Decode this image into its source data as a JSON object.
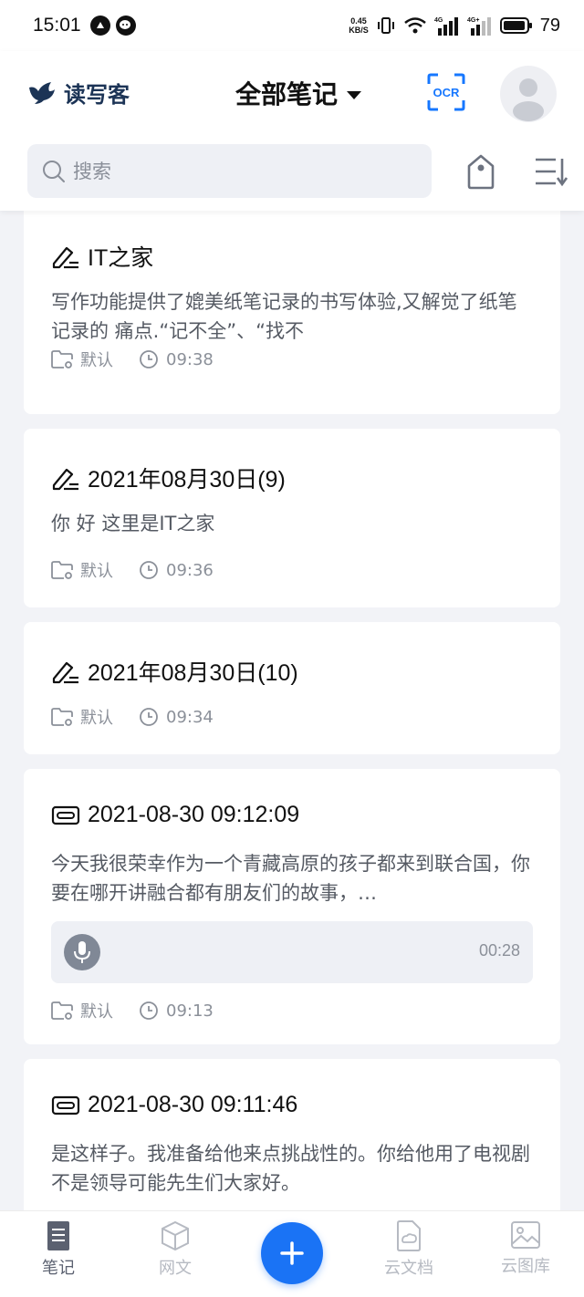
{
  "status_bar": {
    "time": "15:01",
    "net_speed_value": "0.45",
    "net_speed_unit": "KB/S",
    "battery": "79"
  },
  "header": {
    "brand_name": "读写客",
    "title": "全部笔记",
    "ocr_label": "OCR"
  },
  "search": {
    "placeholder": "搜索"
  },
  "notes": [
    {
      "type": "handwriting",
      "title": "IT之家",
      "body": "写作功能提供了媲美纸笔记录的书写体验,又解觉了纸笔记录的 痛点.“记不全”、“找不",
      "folder": "默认",
      "time": "09:38"
    },
    {
      "type": "handwriting",
      "title": "2021年08月30日(9)",
      "body": "你 好 这里是IT之家",
      "folder": "默认",
      "time": "09:36"
    },
    {
      "type": "handwriting",
      "title": "2021年08月30日(10)",
      "body": "",
      "folder": "默认",
      "time": "09:34"
    },
    {
      "type": "recording",
      "title": "2021-08-30 09:12:09",
      "body": "今天我很荣幸作为一个青藏高原的孩子都来到联合国，你要在哪开讲融合都有朋友们的故事，…",
      "duration": "00:28",
      "folder": "默认",
      "time": "09:13"
    },
    {
      "type": "recording",
      "title": "2021-08-30 09:11:46",
      "body": "是这样子。我准备给他来点挑战性的。你给他用了电视剧不是领导可能先生们大家好。"
    }
  ],
  "bottom_nav": {
    "items": [
      {
        "label": "笔记",
        "icon": "note-icon",
        "active": true
      },
      {
        "label": "网文",
        "icon": "cube-icon",
        "active": false
      },
      {
        "label": "云文档",
        "icon": "cloud-doc-icon",
        "active": false
      },
      {
        "label": "云图库",
        "icon": "gallery-icon",
        "active": false
      }
    ],
    "fab_icon": "plus-icon"
  },
  "colors": {
    "accent": "#1a73f5",
    "brand": "#1c3456",
    "background": "#f2f3f7"
  }
}
